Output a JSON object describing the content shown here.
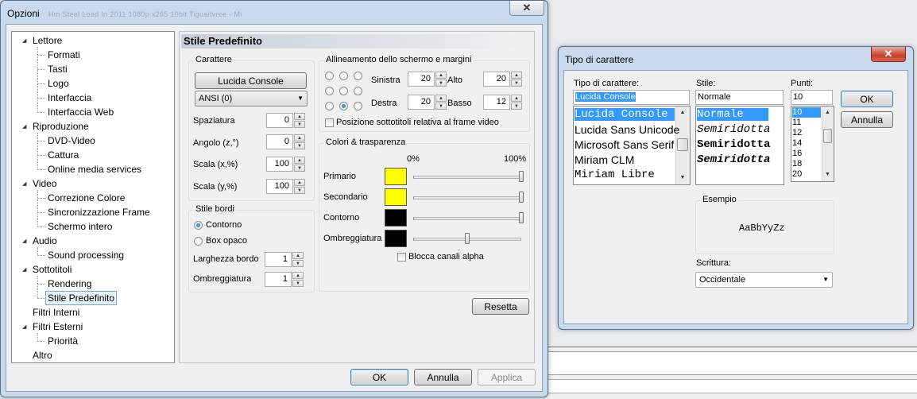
{
  "options_window": {
    "title": "Opzioni",
    "ghost_title": "Hm Steel Load In 2011 1080p x265 10bit Tiguaitvree - Mi",
    "close_glyph": "✕",
    "tree": [
      {
        "label": "Lettore",
        "level": 0,
        "expander": "◢"
      },
      {
        "label": "Formati",
        "level": 1
      },
      {
        "label": "Tasti",
        "level": 1
      },
      {
        "label": "Logo",
        "level": 1
      },
      {
        "label": "Interfaccia",
        "level": 1
      },
      {
        "label": "Interfaccia Web",
        "level": 1
      },
      {
        "label": "Riproduzione",
        "level": 0,
        "expander": "◢"
      },
      {
        "label": "DVD-Video",
        "level": 1
      },
      {
        "label": "Cattura",
        "level": 1
      },
      {
        "label": "Online media services",
        "level": 1
      },
      {
        "label": "Video",
        "level": 0,
        "expander": "◢"
      },
      {
        "label": "Correzione Colore",
        "level": 1
      },
      {
        "label": "Sincronizzazione Frame",
        "level": 1
      },
      {
        "label": "Schermo intero",
        "level": 1
      },
      {
        "label": "Audio",
        "level": 0,
        "expander": "◢"
      },
      {
        "label": "Sound processing",
        "level": 1
      },
      {
        "label": "Sottotitoli",
        "level": 0,
        "expander": "◢"
      },
      {
        "label": "Rendering",
        "level": 1
      },
      {
        "label": "Stile Predefinito",
        "level": 1,
        "selected": true
      },
      {
        "label": "Filtri Interni",
        "level": 0
      },
      {
        "label": "Filtri Esterni",
        "level": 0,
        "expander": "◢"
      },
      {
        "label": "Priorità",
        "level": 1
      },
      {
        "label": "Altro",
        "level": 0
      }
    ],
    "page_title": "Stile Predefinito",
    "carattere": {
      "group_label": "Carattere",
      "font_button": "Lucida Console",
      "charset": "ANSI (0)",
      "spaziatura": {
        "label": "Spaziatura",
        "value": "0"
      },
      "angolo": {
        "label": "Angolo (z,°)",
        "value": "0"
      },
      "scala_x": {
        "label": "Scala (x,%)",
        "value": "100"
      },
      "scala_y": {
        "label": "Scala (y,%)",
        "value": "100"
      }
    },
    "stile_bordi": {
      "group_label": "Stile bordi",
      "contorno": "Contorno",
      "box_opaco": "Box opaco",
      "larghezza": {
        "label": "Larghezza bordo",
        "value": "1"
      },
      "ombreggiatura": {
        "label": "Ombreggiatura",
        "value": "1"
      }
    },
    "allineamento": {
      "group_label": "Allineamento dello schermo e margini",
      "sinistra": {
        "label": "Sinistra",
        "value": "20"
      },
      "alto": {
        "label": "Alto",
        "value": "20"
      },
      "destra": {
        "label": "Destra",
        "value": "20"
      },
      "basso": {
        "label": "Basso",
        "value": "12"
      },
      "posizione_label": "Posizione sottotitoli relativa al frame video",
      "selected_position": "bottom-center"
    },
    "colori": {
      "group_label": "Colori & trasparenza",
      "min_label": "0%",
      "max_label": "100%",
      "rows": [
        {
          "label": "Primario",
          "color": "#ffff00",
          "alpha": 1.0
        },
        {
          "label": "Secondario",
          "color": "#ffff00",
          "alpha": 1.0
        },
        {
          "label": "Contorno",
          "color": "#000000",
          "alpha": 1.0
        },
        {
          "label": "Ombreggiatura",
          "color": "#000000",
          "alpha": 0.5
        }
      ],
      "blocca_label": "Blocca canali alpha"
    },
    "resetta": "Resetta",
    "ok": "OK",
    "annulla": "Annulla",
    "applica": "Applica"
  },
  "font_dialog": {
    "title": "Tipo di carattere",
    "close_glyph": "✕",
    "font_label": "Tipo di carattere:",
    "font_value": "Lucida Console",
    "fonts": [
      "Lucida Console",
      "Lucida Sans Unicode",
      "Microsoft Sans Serif",
      "Miriam CLM",
      "Miriam Libre"
    ],
    "style_label": "Stile:",
    "style_value": "Normale",
    "styles": [
      "Normale",
      "Semiridotta",
      "Semiridotta",
      "Semiridotta"
    ],
    "size_label": "Punti:",
    "size_value": "10",
    "sizes": [
      "10",
      "11",
      "12",
      "14",
      "16",
      "18",
      "20"
    ],
    "ok": "OK",
    "annulla": "Annulla",
    "esempio_label": "Esempio",
    "esempio_text": "AaBbYyZz",
    "scrittura_label": "Scrittura:",
    "scrittura_value": "Occidentale"
  },
  "icons": {
    "dropdown": "▼",
    "up": "▲",
    "down": "▼"
  }
}
